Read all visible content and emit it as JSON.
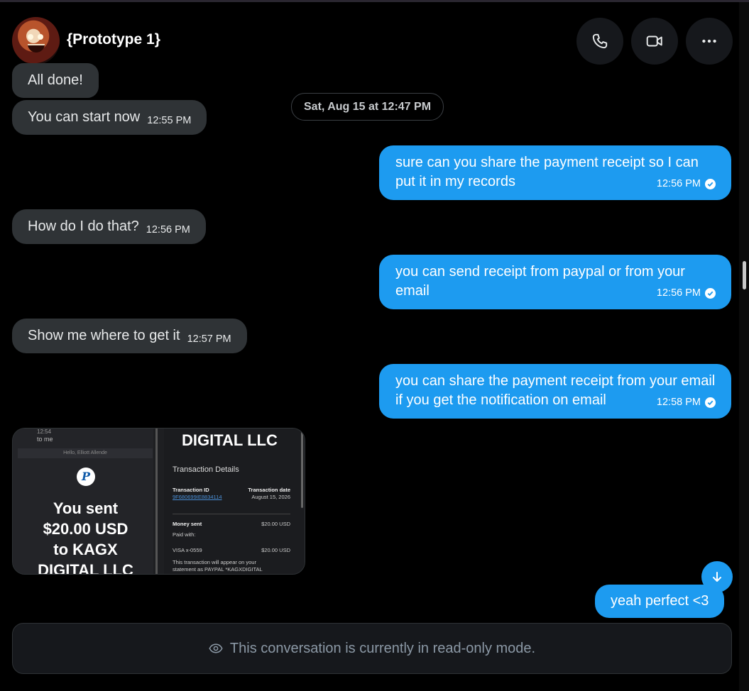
{
  "header": {
    "title": "{Prototype 1}",
    "actions": [
      "call",
      "video",
      "more"
    ]
  },
  "date_separator": "Sat, Aug 15 at 12:47 PM",
  "messages": [
    {
      "dir": "in",
      "text": "All done!",
      "time": ""
    },
    {
      "dir": "in",
      "text": "You can start now",
      "time": "12:55 PM"
    },
    {
      "dir": "out",
      "text": "sure can you share the payment receipt so I can put it in my records",
      "time": "12:56 PM"
    },
    {
      "dir": "in",
      "text": "How do I do that?",
      "time": "12:56 PM"
    },
    {
      "dir": "out",
      "text": "you can send receipt from paypal or from your email",
      "time": "12:56 PM"
    },
    {
      "dir": "in",
      "text": "Show me where to get it",
      "time": "12:57 PM"
    },
    {
      "dir": "out",
      "text": "you can share the payment receipt from your email if you get the notification on email",
      "time": "12:58 PM"
    },
    {
      "dir": "out",
      "text": "yeah perfect <3",
      "time": ""
    }
  ],
  "receipt_image": {
    "status_time": "12:54",
    "to": "to me",
    "hello": "Hello, Elliott Allende",
    "logo": "P",
    "sent_lines": [
      "You sent",
      "$20.00 USD",
      "to KAGX",
      "DIGITAL LLC"
    ],
    "company": "DIGITAL LLC",
    "details_title": "Transaction Details",
    "tx_id_label": "Transaction ID",
    "tx_id": "9F680699IE8834114",
    "tx_date_label": "Transaction date",
    "tx_date": "August 15, 2026",
    "money_sent_label": "Money sent",
    "money_sent": "$20.00 USD",
    "paid_with": "Paid with:",
    "card": "VISA x-0559",
    "card_amount": "$20.00 USD",
    "statement_line1": "This transaction will appear on your",
    "statement_line2": "statement as PAYPAL *KAGXDIGITAL"
  },
  "footer": {
    "readonly_text": "This conversation is currently in read-only mode."
  },
  "colors": {
    "outgoing": "#1d9bf0",
    "incoming": "#2f3336",
    "background": "#000000"
  }
}
